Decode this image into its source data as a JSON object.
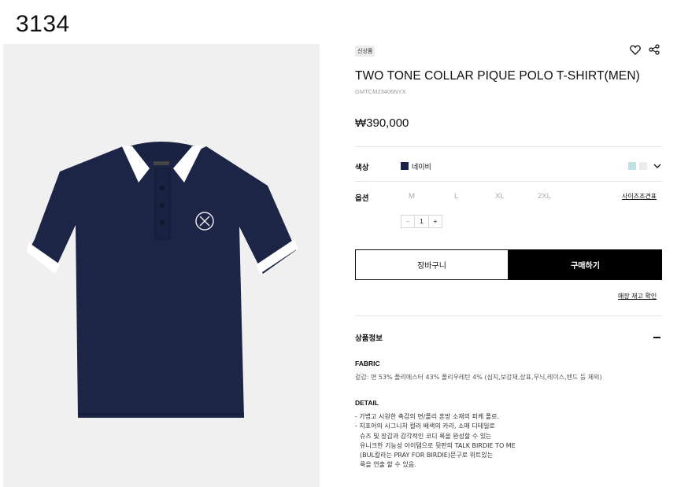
{
  "page_number": "3134",
  "product": {
    "badge": "신상품",
    "title": "TWO TONE COLLAR PIQUE POLO T-SHIRT(MEN)",
    "code": "GMTCM23406NYX",
    "price": "₩390,000"
  },
  "color": {
    "label": "색상",
    "selected_name": "네이비",
    "selected_hex": "#1b2447",
    "other_swatches": [
      "#bfe1e4",
      "#ececec"
    ]
  },
  "option": {
    "label": "옵션",
    "sizes": [
      "M",
      "L",
      "XL",
      "2XL"
    ],
    "size_guide": "사이즈조견표"
  },
  "quantity": {
    "minus": "−",
    "value": "1",
    "plus": "+"
  },
  "actions": {
    "cart": "장바구니",
    "buy": "구매하기",
    "store_stock": "매장 재고 확인"
  },
  "info_section": {
    "title": "상품정보",
    "fabric_title": "FABRIC",
    "fabric_text": "겉감: 면 53% 폴리에스터 43% 폴리우레탄 4% (심지,보강재,상표,무늬,레이스,밴드 등 제외)",
    "detail_title": "DETAIL",
    "detail_lines": [
      "- 가볍고 시원한 촉감의 면/폴리 혼방 소재의 피케 폴로.",
      "- 지포어의 시그니처 컬러 배색의 카라, 소매 디테일로",
      "  슈즈 및 장갑과 감각적인 코디 룩을 완성할 수 있는",
      "  유니크한 기능성 아이템으로 뒷판의 TALK BIRDIE TO ME",
      "  (BUL칼라는 PRAY FOR BIRDIE)문구로 위트있는",
      "  룩을 연출 할 수 있음."
    ]
  },
  "icons": {
    "heart": "heart-icon",
    "share": "share-icon",
    "chevron": "chevron-down-icon",
    "collapse": "minus-icon"
  }
}
